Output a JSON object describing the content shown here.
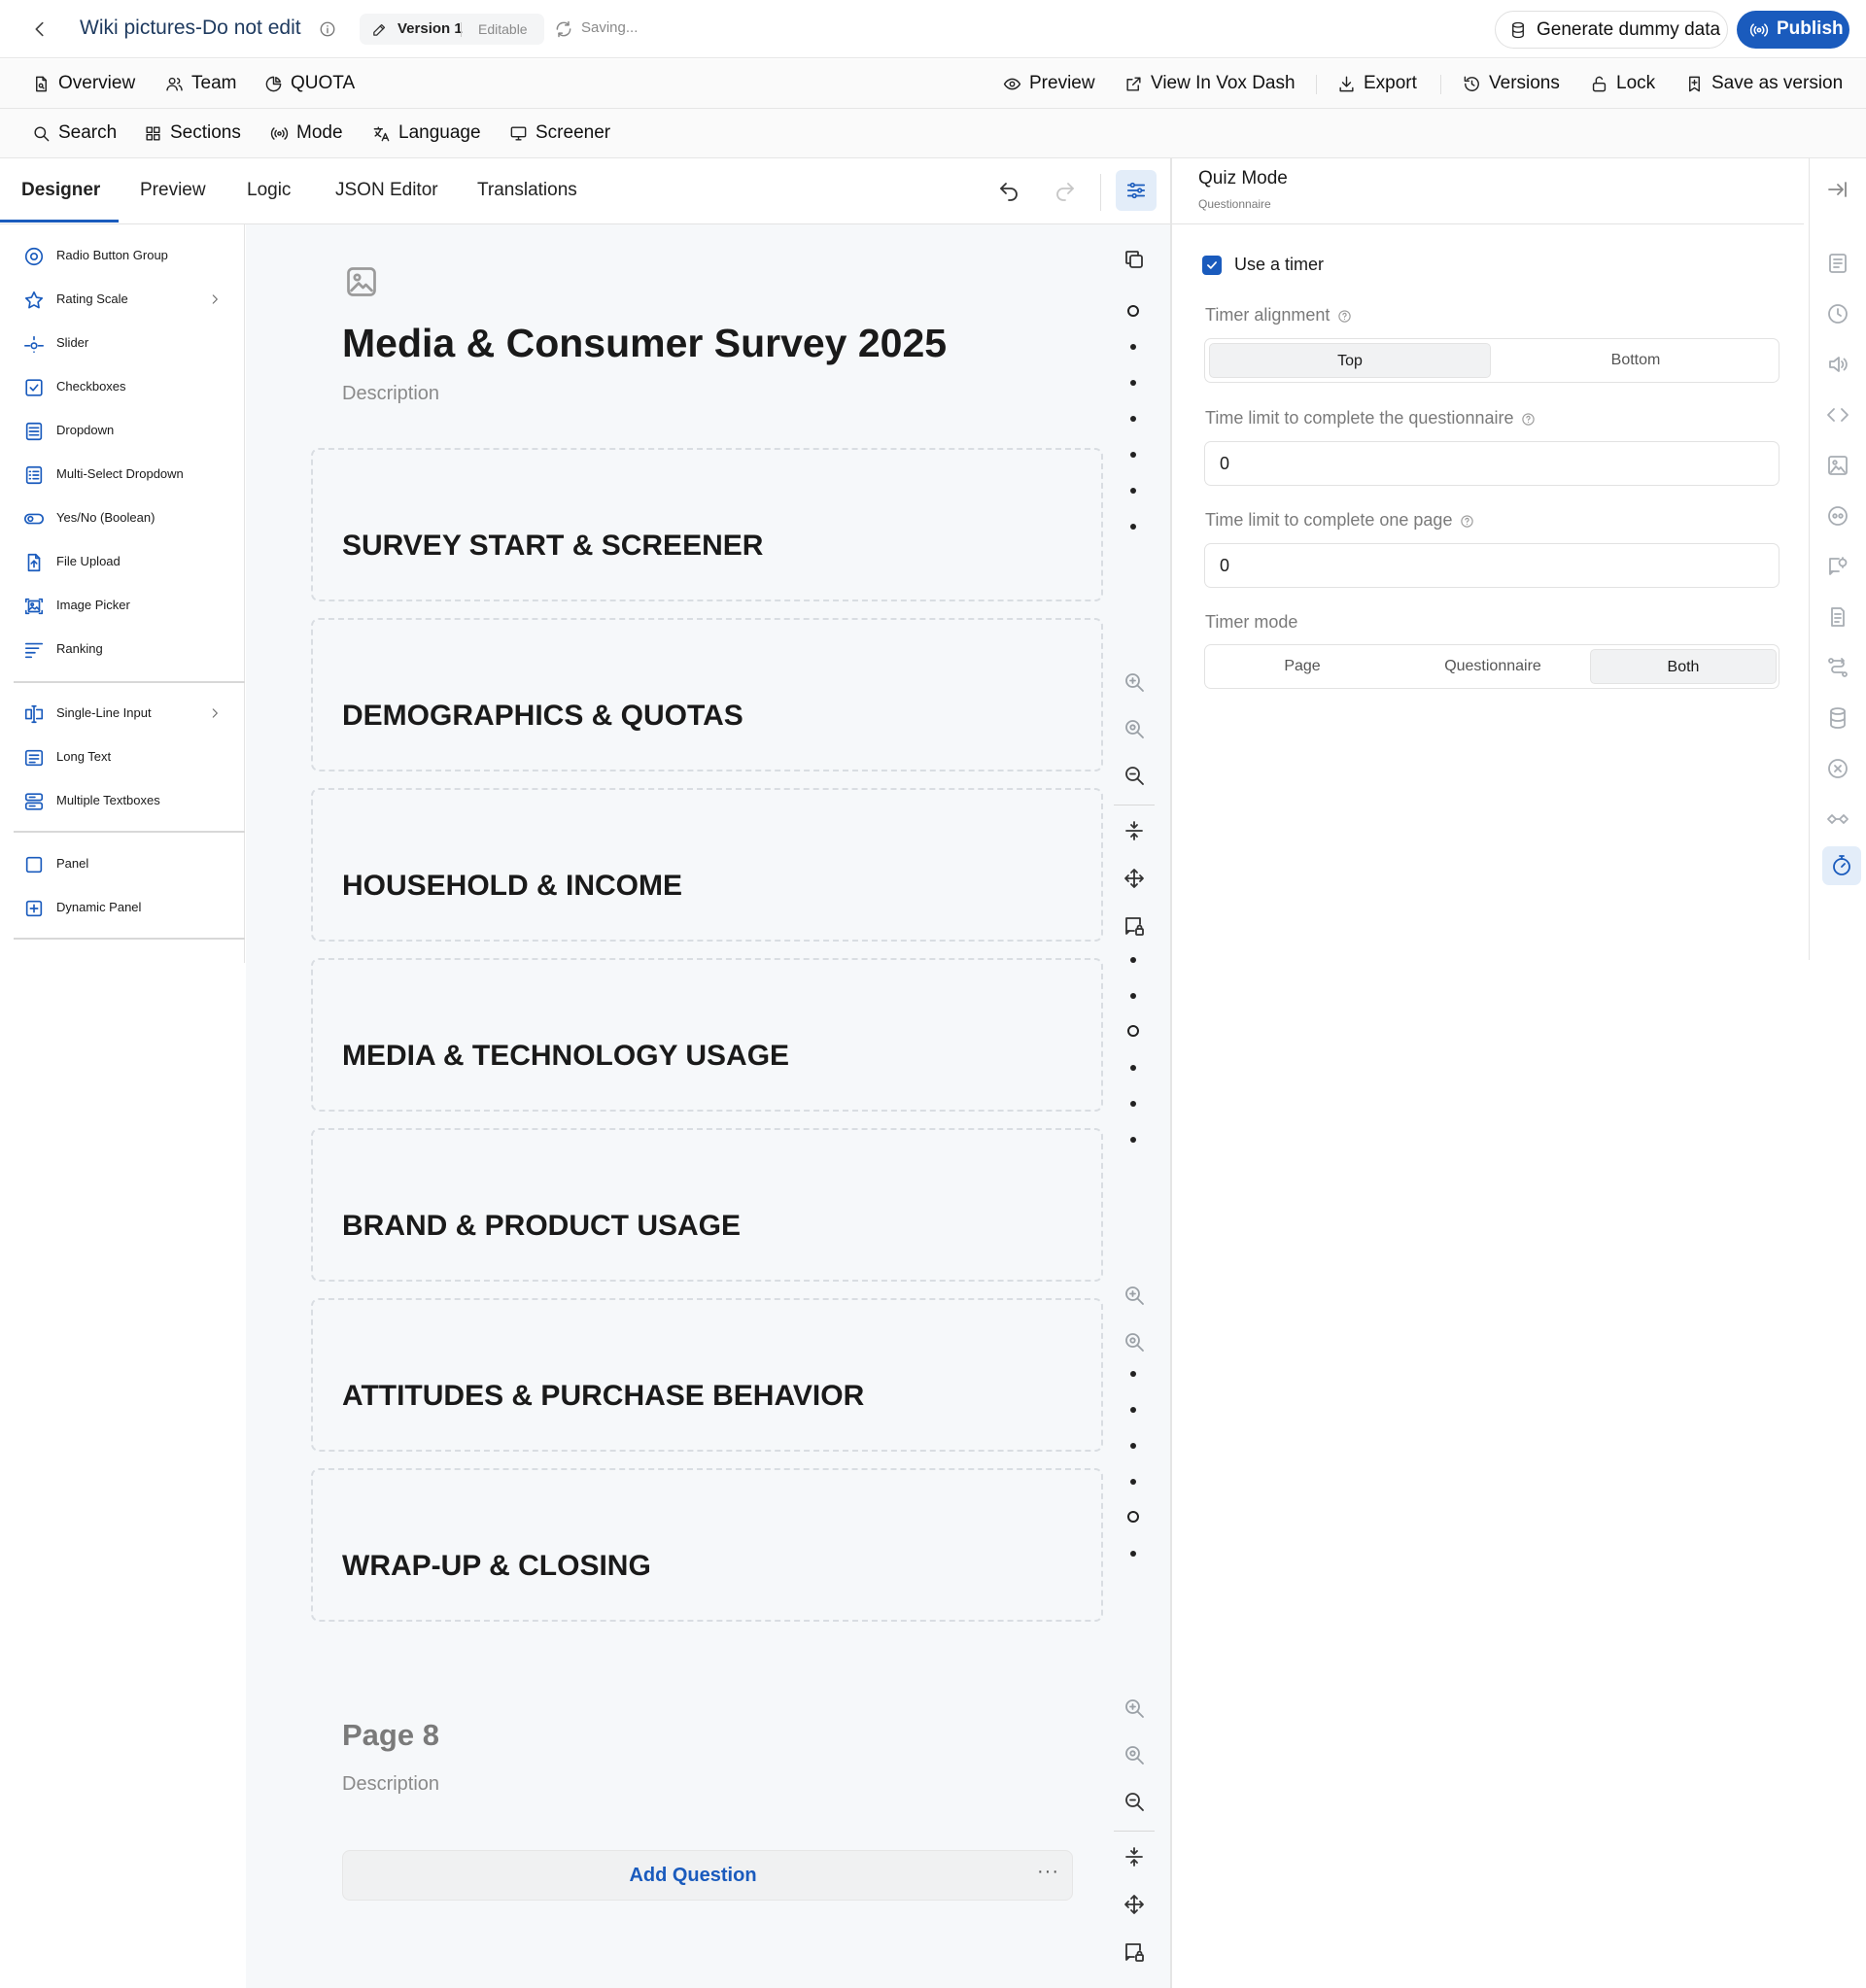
{
  "header": {
    "document_title": "Wiki pictures-Do not edit",
    "version_label": "Version 1",
    "version_state": "Editable",
    "saving_status": "Saving...",
    "generate_dummy_label": "Generate dummy data",
    "publish_label": "Publish"
  },
  "toolbar_primary": {
    "overview": "Overview",
    "team": "Team",
    "quota": "QUOTA",
    "preview": "Preview",
    "view_in_vox_dash": "View In Vox Dash",
    "export": "Export",
    "versions": "Versions",
    "lock": "Lock",
    "save_as_version": "Save as version"
  },
  "toolbar_secondary": {
    "search": "Search",
    "sections": "Sections",
    "mode": "Mode",
    "language": "Language",
    "screener": "Screener"
  },
  "designer_tabs": [
    "Designer",
    "Preview",
    "Logic",
    "JSON Editor",
    "Translations"
  ],
  "toolbox": {
    "group1": [
      {
        "label": "Radio Button Group",
        "icon": "radio-button-icon"
      },
      {
        "label": "Rating Scale",
        "icon": "star-icon",
        "has_submenu": true
      },
      {
        "label": "Slider",
        "icon": "slider-icon"
      },
      {
        "label": "Checkboxes",
        "icon": "checkbox-icon"
      },
      {
        "label": "Dropdown",
        "icon": "dropdown-icon"
      },
      {
        "label": "Multi-Select Dropdown",
        "icon": "multi-select-icon"
      },
      {
        "label": "Yes/No (Boolean)",
        "icon": "toggle-icon"
      },
      {
        "label": "File Upload",
        "icon": "file-upload-icon"
      },
      {
        "label": "Image Picker",
        "icon": "image-picker-icon"
      },
      {
        "label": "Ranking",
        "icon": "ranking-icon"
      }
    ],
    "group2": [
      {
        "label": "Single-Line Input",
        "icon": "text-cursor-icon",
        "has_submenu": true
      },
      {
        "label": "Long Text",
        "icon": "long-text-icon"
      },
      {
        "label": "Multiple Textboxes",
        "icon": "multiple-textboxes-icon"
      }
    ],
    "group3": [
      {
        "label": "Panel",
        "icon": "panel-icon"
      },
      {
        "label": "Dynamic Panel",
        "icon": "dynamic-panel-icon"
      }
    ]
  },
  "survey": {
    "title": "Media & Consumer Survey 2025",
    "description_placeholder": "Description",
    "panels": [
      "SURVEY START & SCREENER",
      "DEMOGRAPHICS & QUOTAS",
      "HOUSEHOLD & INCOME",
      "MEDIA & TECHNOLOGY USAGE",
      "BRAND & PRODUCT USAGE",
      "ATTITUDES & PURCHASE BEHAVIOR",
      "WRAP-UP & CLOSING"
    ],
    "page8": {
      "title": "Page 8",
      "description_placeholder": "Description",
      "add_question_label": "Add Question",
      "more_label": "···"
    }
  },
  "properties": {
    "title": "Quiz Mode",
    "subtitle": "Questionnaire",
    "use_timer_label": "Use a timer",
    "use_timer_checked": true,
    "timer_alignment_label": "Timer alignment",
    "timer_alignment_options": [
      "Top",
      "Bottom"
    ],
    "timer_alignment_selected": "Top",
    "time_limit_questionnaire_label": "Time limit to complete the questionnaire",
    "time_limit_questionnaire_value": "0",
    "time_limit_page_label": "Time limit to complete one page",
    "time_limit_page_value": "0",
    "timer_mode_label": "Timer mode",
    "timer_mode_options": [
      "Page",
      "Questionnaire",
      "Both"
    ],
    "timer_mode_selected": "Both"
  },
  "colors": {
    "accent": "#1a5bbd",
    "accent_soft": "#e3edf9",
    "canvas_bg": "#f6f8fa"
  }
}
